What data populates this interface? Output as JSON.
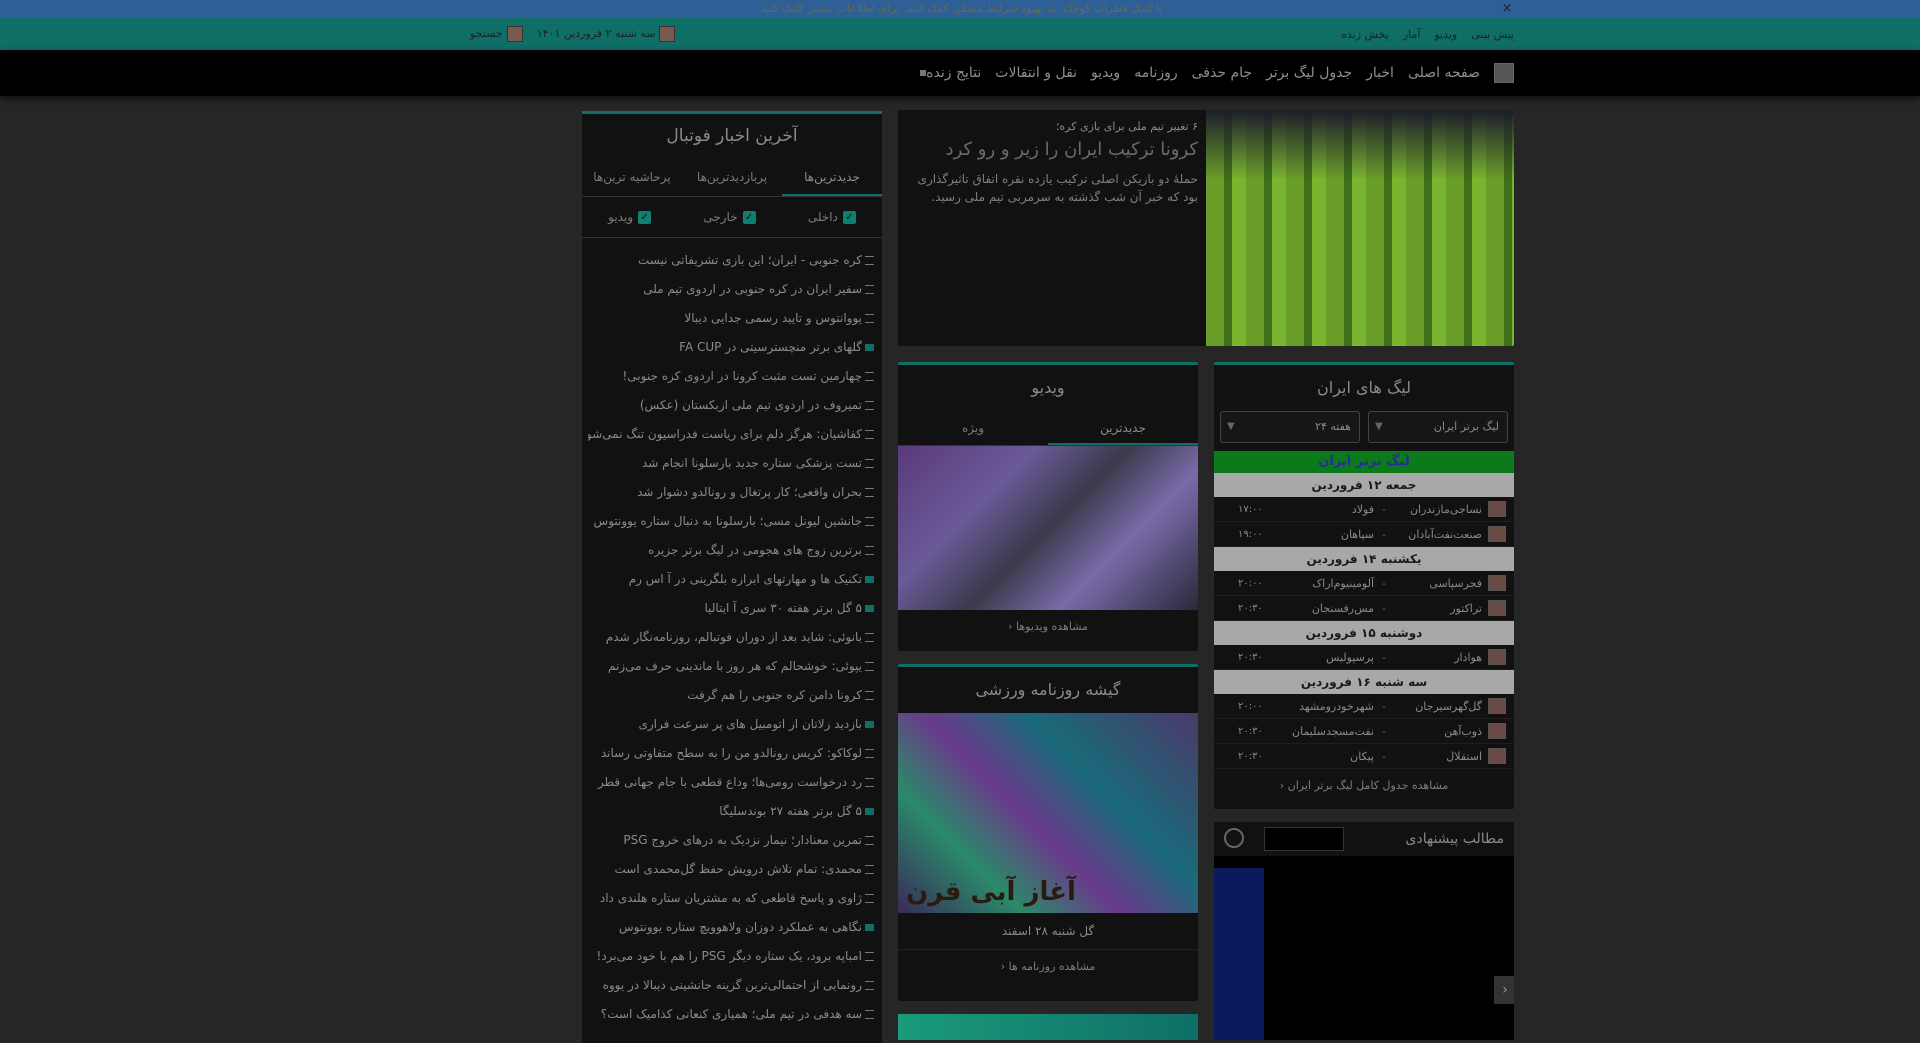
{
  "banner": {
    "text": "با کمک قطرات کوچک، به بهبود شرایط مسکن کمک کنید. برای اطلاعات بیشتر کلیک کنید.",
    "close": "×"
  },
  "topbar": {
    "links": [
      "پخش زنده",
      "آمار",
      "ویدیو",
      "پیش بینی"
    ],
    "date": "سه شنبه ۲ فروردین ۱۴۰۱",
    "search": "جستجو"
  },
  "nav": {
    "items": [
      "صفحه اصلی",
      "اخبار",
      "جدول لیگ برتر",
      "جام حذفی",
      "روزنامه",
      "ویدیو",
      "نقل و انتقالات",
      "نتایج زنده"
    ]
  },
  "latest": {
    "title": "آخرین اخبار فوتبال",
    "tabs": [
      "جدیدترین‌ها",
      "پربازدیدترین‌ها",
      "پرحاشیه ترین‌ها"
    ],
    "filters": [
      "داخلی",
      "خارجی",
      "ویدیو"
    ],
    "items": [
      {
        "t": "کره جنوبی - ایران؛ این بازی تشریفاتی نیست",
        "k": "text"
      },
      {
        "t": "سفیر ایران در کره جنوبی در اردوی تیم ملی",
        "k": "text"
      },
      {
        "t": "یووانتوس و تایید رسمی جدایی دیبالا",
        "k": "text"
      },
      {
        "t": "گلهای برتر منچسترسیتی در FA CUP",
        "k": "vid"
      },
      {
        "t": "چهارمین تست مثبت کرونا در اردوی کره جنوبی!",
        "k": "text"
      },
      {
        "t": "تمیروف در اردوی تیم ملی ازبکستان (عکس)",
        "k": "text"
      },
      {
        "t": "کفاشیان: هرگز دلم برای ریاست فدراسیون تنگ نمی‌شود",
        "k": "text"
      },
      {
        "t": "تست پزشکی ستاره جدید بارسلونا انجام شد",
        "k": "text"
      },
      {
        "t": "بحران واقعی؛ کار پرتغال و رونالدو دشوار شد",
        "k": "text"
      },
      {
        "t": "جانشین لیونل مسی؛ بارسلونا به دنبال ستاره یوونتوس",
        "k": "text"
      },
      {
        "t": "برترین زوج های هجومی در لیگ برتر جزیره",
        "k": "text"
      },
      {
        "t": "تکنیک ها و مهارتهای ابرازه بلگرینی در آ اس رم",
        "k": "vid"
      },
      {
        "t": "۵ گل برتر هفته ۳۰ سری آ ایتالیا",
        "k": "vid"
      },
      {
        "t": "بانوئی: شاید بعد از دوران فوتبالم، روزنامه‌نگار شدم",
        "k": "text"
      },
      {
        "t": "یپوئی: خوشحالم که هر روز با ماندینی حرف می‌زنم",
        "k": "text"
      },
      {
        "t": "کرونا دامن کره جنوبی را هم گرفت",
        "k": "text"
      },
      {
        "t": "بازدید زلاتان از اتومبیل های پر سرعت فراری",
        "k": "vid"
      },
      {
        "t": "لوکاکو: کریس رونالدو من را به سطح متفاوتی رساند",
        "k": "text"
      },
      {
        "t": "رد درخواست رومی‌ها؛ وداع قطعی با جام جهانی قطر",
        "k": "text"
      },
      {
        "t": "۵ گل برتر هفته ۲۷ بوندسلیگا",
        "k": "vid"
      },
      {
        "t": "تمرین معنادار؛ نیمار نزدیک به درهای خروج PSG",
        "k": "text"
      },
      {
        "t": "محمدی: تمام تلاش درویش حفظ گل‌محمدی است",
        "k": "text"
      },
      {
        "t": "ژاوی و پاسخ قاطعی که به مشتریان ستاره هلندی داد",
        "k": "text"
      },
      {
        "t": "نگاهی به عملکرد دوزان ولاهوویچ ستاره یوونتوس",
        "k": "vid"
      },
      {
        "t": "امباپه برود، یک ستاره دیگر PSG را هم با خود می‌برد!",
        "k": "text"
      },
      {
        "t": "رونمایی از احتمالی‌ترین گزینه جانشینی دیبالا در یووه",
        "k": "text"
      },
      {
        "t": "سه هدفی در تیم ملی؛ همیاری کنعانی کذامیک است؟",
        "k": "text"
      }
    ]
  },
  "hero": {
    "kicker": "۶ تغییر تیم ملی برای بازی کره؛",
    "title": "کرونا ترکیب ایران را زیر و رو کرد",
    "desc": "حملهٔ دو بازیکن اصلی ترکیب یازده نفره اتفاق تاثیرگذاری بود که خبر آن شب گذشته به سرمربی تیم ملی رسید."
  },
  "leagues": {
    "title": "لیگ های ایران",
    "select_league": "لیگ برتر ایران",
    "select_week": "هفته ۲۴",
    "league_name": "لیگ برتر ایران",
    "days": [
      {
        "label": "جمعه ۱۲ فروردین",
        "matches": [
          {
            "home": "نساجی‌مازندران",
            "away": "فولاد",
            "time": "۱۷:۰۰"
          },
          {
            "home": "صنعت‌نفت‌آبادان",
            "away": "سپاهان",
            "time": "۱۹:۰۰"
          }
        ]
      },
      {
        "label": "یکشنبه ۱۴ فروردین",
        "matches": [
          {
            "home": "فجرسپاسی",
            "away": "آلومینیوم‌اراک",
            "time": "۲۰:۰۰"
          },
          {
            "home": "تراکتور",
            "away": "مس‌رفسنجان",
            "time": "۲۰:۳۰"
          }
        ]
      },
      {
        "label": "دوشنبه ۱۵ فروردین",
        "matches": [
          {
            "home": "هوادار",
            "away": "پرسپولیس",
            "time": "۲۰:۳۰"
          }
        ]
      },
      {
        "label": "سه شنبه ۱۶ فروردین",
        "matches": [
          {
            "home": "گل‌گهرسیرجان",
            "away": "شهرخودرومشهد",
            "time": "۲۰:۰۰"
          },
          {
            "home": "ذوب‌آهن",
            "away": "نفت‌مسجدسلیمان",
            "time": "۲۰:۳۰"
          },
          {
            "home": "استقلال",
            "away": "پیکان",
            "time": "۲۰:۳۰"
          }
        ]
      }
    ],
    "more": "مشاهده جدول کامل لیگ برتر ایران"
  },
  "video": {
    "title": "ویدیو",
    "tabs": [
      "جدیدترین",
      "ویژه"
    ],
    "more": "مشاهده ویدیوها"
  },
  "paper": {
    "title": "گیشه روزنامه ورزشی",
    "masthead": "آغاز آبی قرن",
    "caption": "گل شنبه ۲۸ اسفند",
    "more": "مشاهده روزنامه ها"
  },
  "suggest": {
    "title": "مطالب پیشنهادی",
    "prev": "‹",
    "next": "›"
  },
  "colors": {
    "accent": "#0f6f67",
    "banner": "#2f5f97",
    "league_green": "#0a7a1a"
  }
}
